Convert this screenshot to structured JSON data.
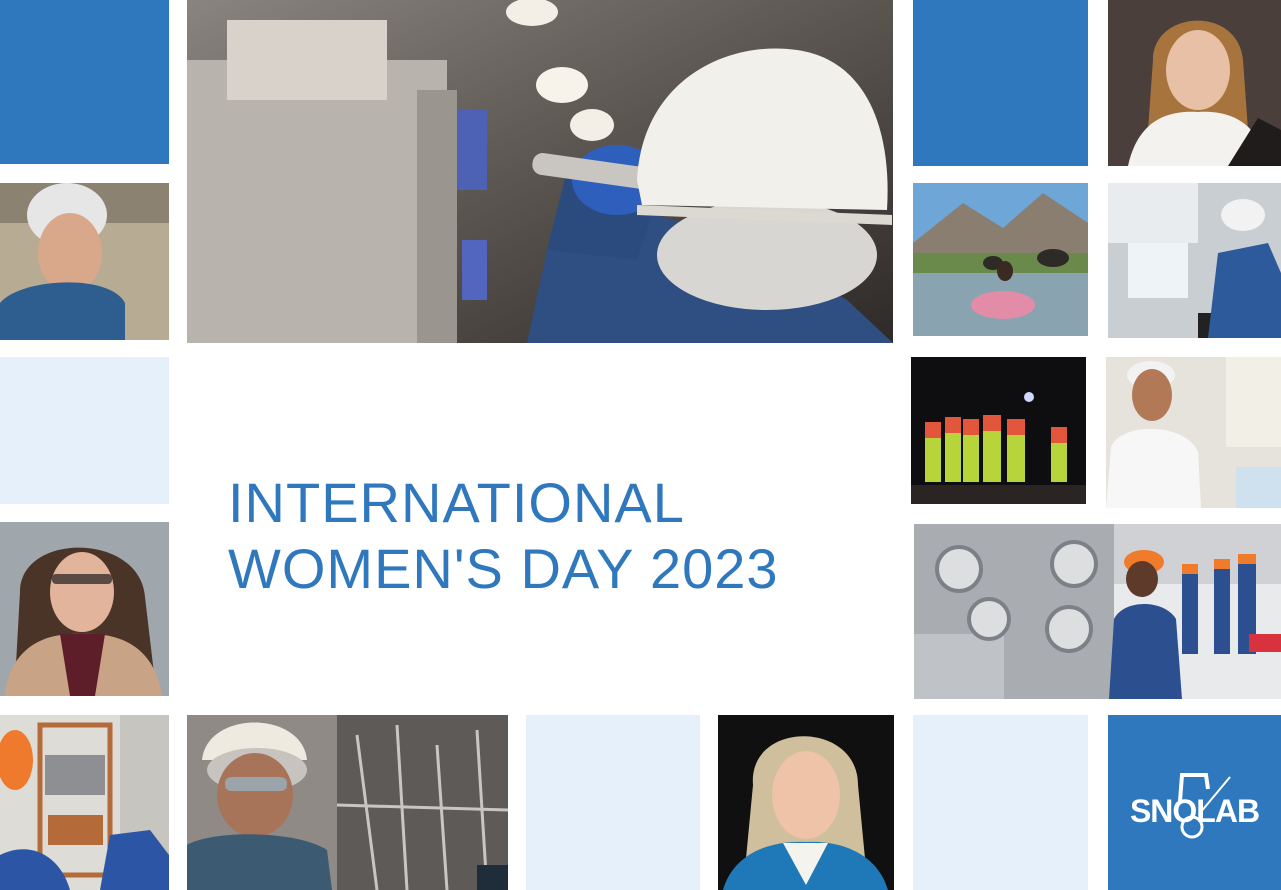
{
  "headline": {
    "line1": "INTERNATIONAL",
    "line2": "WOMEN'S DAY 2023"
  },
  "logo": {
    "text": "SNOLAB"
  },
  "colors": {
    "brand_blue": "#2f78bd",
    "pale_blue": "#e6f0fb",
    "background": "#ffffff"
  }
}
